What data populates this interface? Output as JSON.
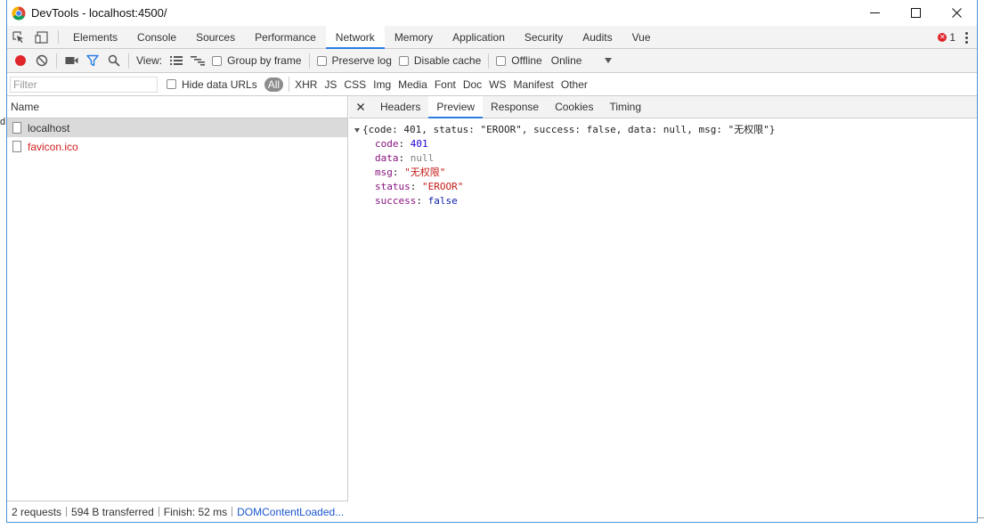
{
  "window": {
    "title": "DevTools - localhost:4500/"
  },
  "background": {
    "stray_char": "d"
  },
  "panel_tabs": [
    {
      "label": "Elements"
    },
    {
      "label": "Console"
    },
    {
      "label": "Sources"
    },
    {
      "label": "Performance"
    },
    {
      "label": "Network",
      "active": true
    },
    {
      "label": "Memory"
    },
    {
      "label": "Application"
    },
    {
      "label": "Security"
    },
    {
      "label": "Audits"
    },
    {
      "label": "Vue"
    }
  ],
  "errors": {
    "count": "1"
  },
  "network_toolbar": {
    "view_label": "View:",
    "group_by_frame": "Group by frame",
    "preserve_log": "Preserve log",
    "disable_cache": "Disable cache",
    "offline": "Offline",
    "throttling": "Online"
  },
  "filter_bar": {
    "placeholder": "Filter",
    "hide_data_urls": "Hide data URLs",
    "all_label": "All",
    "types": [
      "XHR",
      "JS",
      "CSS",
      "Img",
      "Media",
      "Font",
      "Doc",
      "WS",
      "Manifest",
      "Other"
    ]
  },
  "requests": {
    "header": "Name",
    "items": [
      {
        "name": "localhost",
        "selected": true
      },
      {
        "name": "favicon.ico",
        "error": true
      }
    ]
  },
  "status": {
    "requests": "2 requests",
    "transferred": "594 B transferred",
    "finish": "Finish: 52 ms",
    "dcl": "DOMContentLoaded..."
  },
  "detail_tabs": [
    {
      "label": "Headers"
    },
    {
      "label": "Preview",
      "active": true
    },
    {
      "label": "Response"
    },
    {
      "label": "Cookies"
    },
    {
      "label": "Timing"
    }
  ],
  "preview": {
    "summary": "{code: 401, status: \"EROOR\", success: false, data: null, msg: \"无权限\"}",
    "rows": [
      {
        "key": "code",
        "value": "401",
        "kind": "num"
      },
      {
        "key": "data",
        "value": "null",
        "kind": "null"
      },
      {
        "key": "msg",
        "value": "\"无权限\"",
        "kind": "str"
      },
      {
        "key": "status",
        "value": "\"EROOR\"",
        "kind": "str"
      },
      {
        "key": "success",
        "value": "false",
        "kind": "bool"
      }
    ]
  },
  "colors": {
    "accent": "#2a7ee2",
    "record": "#e0262c",
    "error_text": "#d21f1f",
    "link": "#1a55d0"
  },
  "icons": {
    "inspect": "inspect-element-icon",
    "device": "device-toolbar-icon",
    "record": "record-icon",
    "clear": "clear-icon",
    "capture": "capture-screenshots-icon",
    "filter": "filter-icon",
    "search": "search-icon",
    "large_rows": "large-request-rows-icon",
    "overview": "show-overview-icon"
  }
}
